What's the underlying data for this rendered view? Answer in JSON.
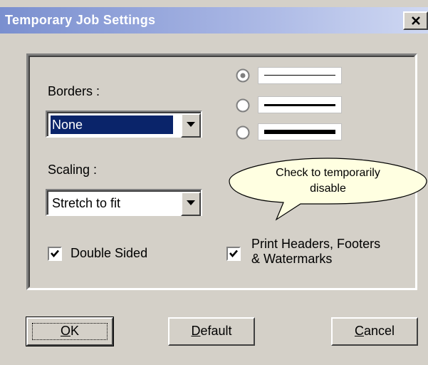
{
  "window": {
    "title": "Temporary Job Settings",
    "close_label": "×"
  },
  "borders": {
    "label": "Borders :",
    "value": "None"
  },
  "scaling": {
    "label": "Scaling :",
    "value": "Stretch to fit"
  },
  "line_styles": [
    {
      "name": "thin",
      "selected": true
    },
    {
      "name": "medium",
      "selected": false
    },
    {
      "name": "thick",
      "selected": false
    }
  ],
  "tooltip": {
    "line1": "Check to temporarily",
    "line2": "disable"
  },
  "double_sided": {
    "label": "Double Sided",
    "checked": true
  },
  "print_headers": {
    "line1": "Print Headers, Footers",
    "line2": "& Watermarks",
    "checked": true
  },
  "buttons": {
    "ok": {
      "mnemonic": "O",
      "rest": "K"
    },
    "default": {
      "mnemonic": "D",
      "rest": "efault"
    },
    "cancel": {
      "mnemonic": "C",
      "rest": "ancel"
    }
  },
  "colors": {
    "title_gradient_start": "#7a8fcf",
    "title_gradient_end": "#cfd8f2",
    "selection": "#0a246a",
    "tooltip_fill": "#ffffe1"
  }
}
